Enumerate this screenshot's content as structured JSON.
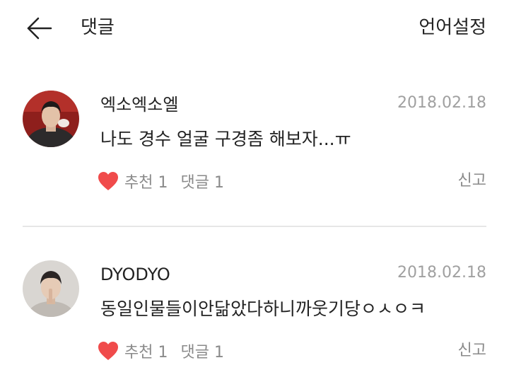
{
  "header": {
    "back_icon": "back-arrow-icon",
    "title": "댓글",
    "lang_setting": "언어설정"
  },
  "comments": [
    {
      "author": "엑소엑소엘",
      "date": "2018.02.18",
      "text": "나도 경수 얼굴 구경좀 해보자...ㅠ",
      "like_label": "추천 1",
      "reply_label": "댓글 1",
      "report_label": "신고"
    },
    {
      "author": "DYODYO",
      "date": "2018.02.18",
      "text": "동일인물들이안닮았다하니까웃기당ㅇㅅㅇㅋ",
      "like_label": "추천 1",
      "reply_label": "댓글 1",
      "report_label": "신고"
    }
  ],
  "colors": {
    "heart": "#f04b4b",
    "meta_text": "#8a8a8a",
    "date_text": "#a0a0a0",
    "divider": "#e6e6e6"
  }
}
